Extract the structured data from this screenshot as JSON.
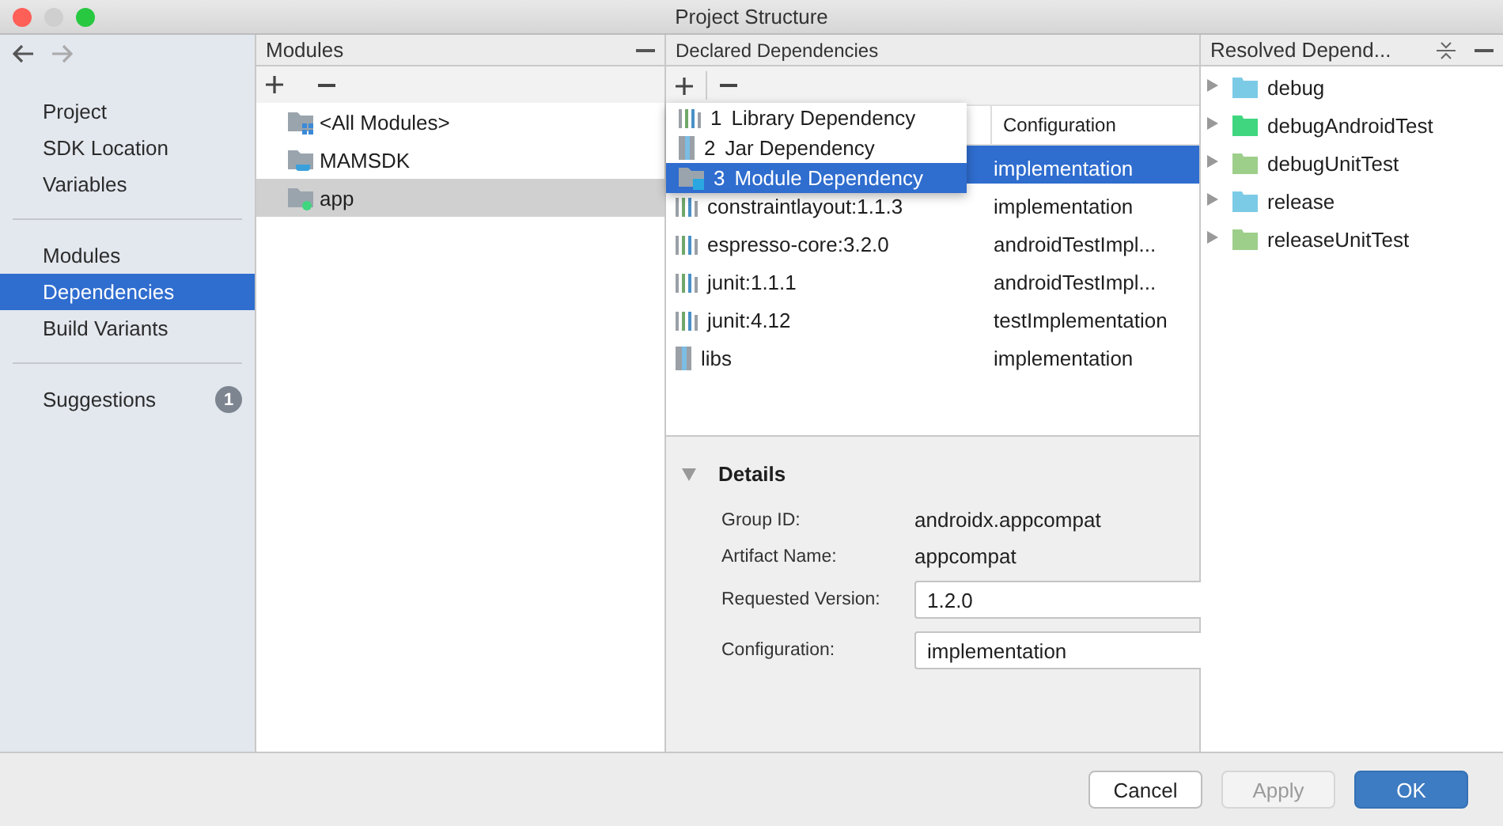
{
  "window": {
    "title": "Project Structure"
  },
  "sidebar": {
    "sections": [
      [
        {
          "label": "Project",
          "selected": false
        },
        {
          "label": "SDK Location",
          "selected": false
        },
        {
          "label": "Variables",
          "selected": false
        }
      ],
      [
        {
          "label": "Modules",
          "selected": false
        },
        {
          "label": "Dependencies",
          "selected": true
        },
        {
          "label": "Build Variants",
          "selected": false
        }
      ],
      [
        {
          "label": "Suggestions",
          "selected": false,
          "badge": "1"
        }
      ]
    ]
  },
  "modules": {
    "title": "Modules",
    "items": [
      {
        "name": "<All Modules>",
        "kind": "all",
        "selected": false
      },
      {
        "name": "MAMSDK",
        "kind": "library",
        "selected": false
      },
      {
        "name": "app",
        "kind": "app",
        "selected": true
      }
    ]
  },
  "declared": {
    "title": "Declared Dependencies",
    "config_column": "Configuration",
    "rows": [
      {
        "configuration": "implementation",
        "selected": true
      },
      {
        "kind": "library",
        "name": "constraintlayout:1.1.3",
        "configuration": "implementation",
        "selected": false
      },
      {
        "kind": "library",
        "name": "espresso-core:3.2.0",
        "configuration": "androidTestImpl...",
        "selected": false
      },
      {
        "kind": "library",
        "name": "junit:1.1.1",
        "configuration": "androidTestImpl...",
        "selected": false
      },
      {
        "kind": "library",
        "name": "junit:4.12",
        "configuration": "testImplementation",
        "selected": false
      },
      {
        "kind": "jar",
        "name": "libs",
        "configuration": "implementation",
        "selected": false
      }
    ],
    "add_menu": [
      {
        "number": "1",
        "label": "Library Dependency",
        "kind": "library",
        "selected": false
      },
      {
        "number": "2",
        "label": "Jar Dependency",
        "kind": "jar",
        "selected": false
      },
      {
        "number": "3",
        "label": "Module Dependency",
        "kind": "module",
        "selected": true
      }
    ]
  },
  "details": {
    "title": "Details",
    "expanded": true,
    "group_id_label": "Group ID:",
    "group_id": "androidx.appcompat",
    "artifact_label": "Artifact Name:",
    "artifact": "appcompat",
    "version_label": "Requested Version:",
    "version": "1.2.0",
    "configuration_label": "Configuration:",
    "configuration": "implementation"
  },
  "resolved": {
    "title": "Resolved Depend...",
    "items": [
      {
        "name": "debug",
        "color": "#7ccbe6",
        "expanded": false
      },
      {
        "name": "debugAndroidTest",
        "color": "#3fd67f",
        "expanded": false
      },
      {
        "name": "debugUnitTest",
        "color": "#9dcf8a",
        "expanded": false
      },
      {
        "name": "release",
        "color": "#7ccbe6",
        "expanded": false
      },
      {
        "name": "releaseUnitTest",
        "color": "#9dcf8a",
        "expanded": false
      }
    ]
  },
  "buttons": [
    {
      "label": "Cancel",
      "kind": "normal",
      "disabled": false
    },
    {
      "label": "Apply",
      "kind": "normal",
      "disabled": true
    },
    {
      "label": "OK",
      "kind": "default",
      "disabled": false
    }
  ]
}
